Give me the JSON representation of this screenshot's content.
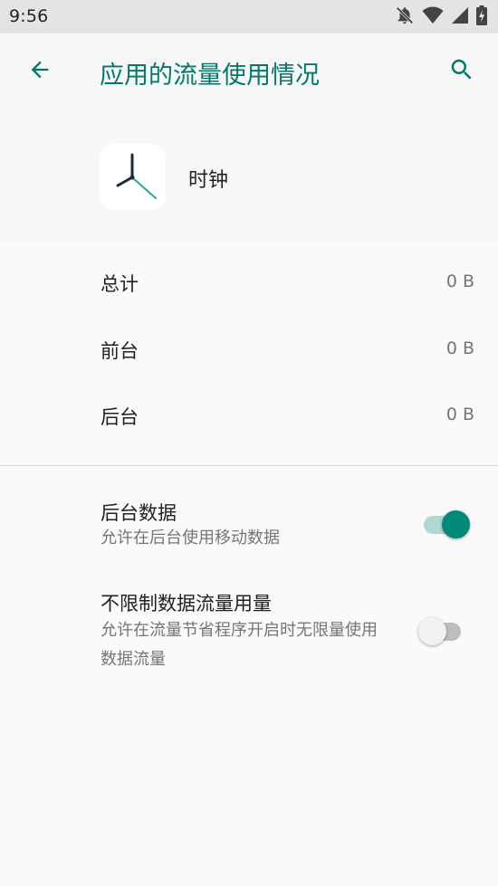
{
  "status_bar": {
    "time": "9:56",
    "icons": [
      "notifications-off-icon",
      "wifi-icon",
      "cell-signal-icon",
      "battery-charging-icon"
    ]
  },
  "toolbar": {
    "title": "应用的流量使用情况",
    "back_icon": "arrow-back-icon",
    "search_icon": "search-icon"
  },
  "app": {
    "name": "时钟",
    "icon": "clock-icon"
  },
  "usage": [
    {
      "label": "总计",
      "value": "0 B"
    },
    {
      "label": "前台",
      "value": "0 B"
    },
    {
      "label": "后台",
      "value": "0 B"
    }
  ],
  "preferences": [
    {
      "title": "后台数据",
      "summary": "允许在后台使用移动数据",
      "enabled": true
    },
    {
      "title": "不限制数据流量用量",
      "summary": "允许在流量节省程序开启时无限量使用数据流量",
      "enabled": false
    }
  ],
  "colors": {
    "accent": "#00796b",
    "switch_on": "#00897b",
    "status_bar_bg": "#e4e4e4",
    "background": "#f7f7f7"
  }
}
